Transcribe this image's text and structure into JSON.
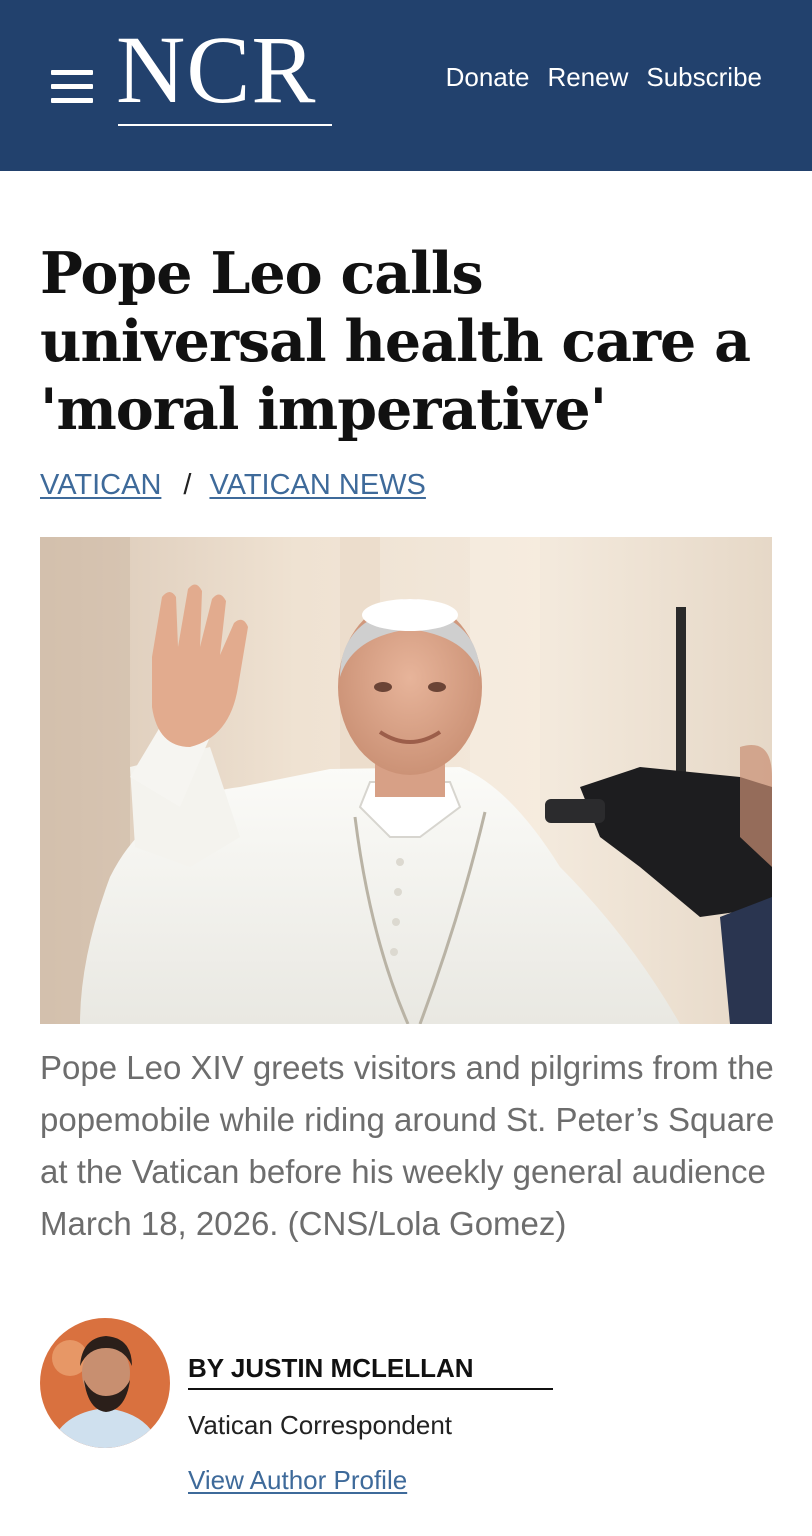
{
  "header": {
    "logo_text": "NCR",
    "nav": [
      "Donate",
      "Renew",
      "Subscribe"
    ],
    "background_color": "#22416d",
    "menu_icon": "hamburger-menu-icon"
  },
  "article": {
    "headline": "Pope Leo calls universal health care a 'moral imperative'",
    "breadcrumb": {
      "section": "VATICAN",
      "separator": "/",
      "subsection": "VATICAN NEWS"
    },
    "caption": "Pope Leo XIV greets visitors and pilgrims from the popemobile while riding around St. Peter’s Square at the Vatican before his weekly general audience March 18, 2026. (CNS/Lola Gomez)"
  },
  "author": {
    "byline": "BY JUSTIN MCLELLAN",
    "role": "Vatican Correspondent",
    "profile_link": "View Author Profile"
  },
  "colors": {
    "link": "#3e6a9a",
    "caption": "#6d6d6d"
  }
}
